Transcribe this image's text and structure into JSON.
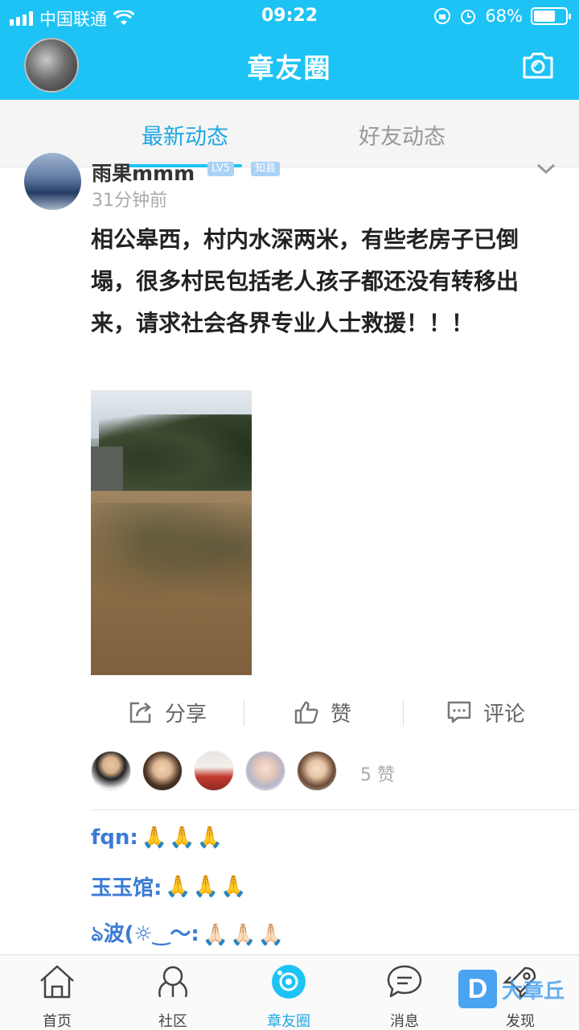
{
  "status_bar": {
    "carrier": "中国联通",
    "time": "09:22",
    "battery": "68%",
    "battery_level": 0.68
  },
  "header": {
    "title": "章友圈"
  },
  "tabs": [
    {
      "label": "最新动态",
      "active": true
    },
    {
      "label": "好友动态",
      "active": false
    }
  ],
  "post": {
    "author": "雨果mmm",
    "badges": [
      "LV5",
      "知县"
    ],
    "time_ago": "31分钟前",
    "text": "相公皋西，村内水深两米，有些老房子已倒塌，很多村民包括老人孩子都还没有转移出来，请求社会各界专业人士救援！！！"
  },
  "actions": {
    "share": "分享",
    "like": "赞",
    "comment": "评论"
  },
  "likes": {
    "count_label": "5 赞"
  },
  "comments": [
    {
      "user": "fqn:",
      "text": "🙏🙏🙏"
    },
    {
      "user": "玉玉馆:",
      "text": "🙏🙏🙏"
    },
    {
      "user": "ঌ波(☼‿〜:",
      "text": "🙏🏻🙏🏻🙏🏻"
    }
  ],
  "bottom_nav": [
    {
      "label": "首页",
      "icon": "home-icon",
      "active": false
    },
    {
      "label": "社区",
      "icon": "community-icon",
      "active": false
    },
    {
      "label": "章友圈",
      "icon": "circle-icon",
      "active": true
    },
    {
      "label": "消息",
      "icon": "message-icon",
      "active": false
    },
    {
      "label": "发现",
      "icon": "discover-icon",
      "active": false
    }
  ],
  "watermark": {
    "letter": "D",
    "text": "大章丘"
  },
  "colors": {
    "brand": "#1ec3f5",
    "active_tab": "#1ea7e3",
    "username": "#3a7bd5"
  }
}
